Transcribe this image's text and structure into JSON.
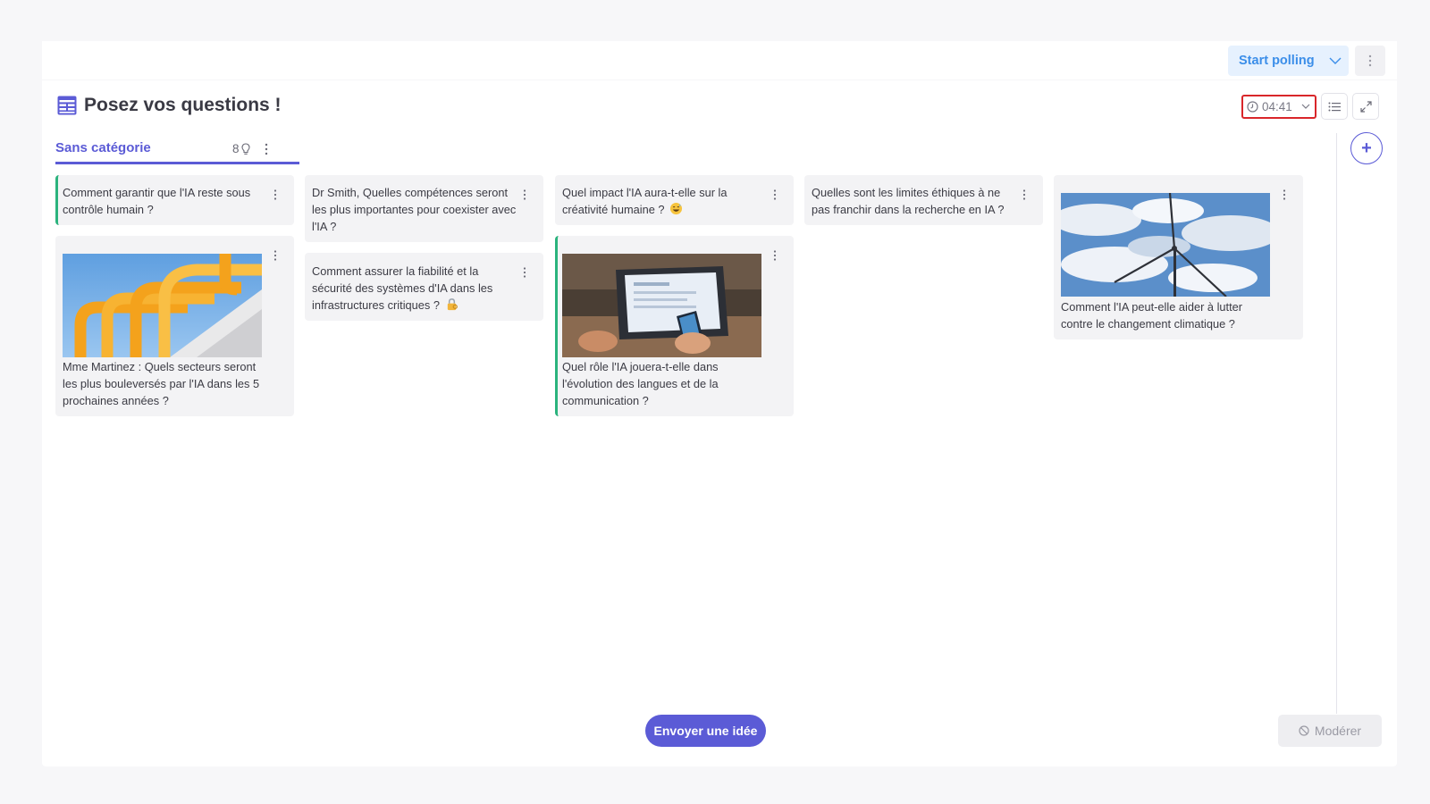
{
  "toolbar": {
    "start_polling_label": "Start polling"
  },
  "board": {
    "title": "Posez vos questions !",
    "timer": "04:41",
    "colors": {
      "accent": "#5b5bd6",
      "highlight_bar": "#2bb37d",
      "timer_border": "#d9262a"
    }
  },
  "category_tab": {
    "label": "Sans catégorie",
    "count": "8"
  },
  "cards": [
    {
      "text": "Comment garantir que l'IA reste sous contrôle humain ?"
    },
    {
      "text": "Mme Martinez : Quels secteurs seront les plus bouleversés par l'IA dans les 5 prochaines années ?",
      "image": "orange-pipes-photo"
    },
    {
      "text": "Dr Smith, Quelles compétences seront les plus importantes pour coexister avec l'IA ?"
    },
    {
      "text": "Comment assurer la fiabilité et la sécurité des systèmes d'IA dans les infrastructures critiques ?",
      "emoji": "lock-with-key-emoji"
    },
    {
      "text": "Quel impact l'IA aura-t-elle sur la créativité humaine ?",
      "emoji": "grinning-sweat-emoji"
    },
    {
      "text": "Quel rôle l'IA jouera-t-elle dans l'évolution des langues et de la communication ?",
      "image": "laptop-phone-photo"
    },
    {
      "text": "Quelles sont les limites éthiques à ne pas franchir dans la recherche en IA ?"
    },
    {
      "text": "Comment l'IA peut-elle aider à lutter contre le changement climatique ?",
      "image": "wind-turbine-photo"
    }
  ],
  "footer": {
    "send_label": "Envoyer une idée",
    "moderate_label": "Modérer"
  }
}
